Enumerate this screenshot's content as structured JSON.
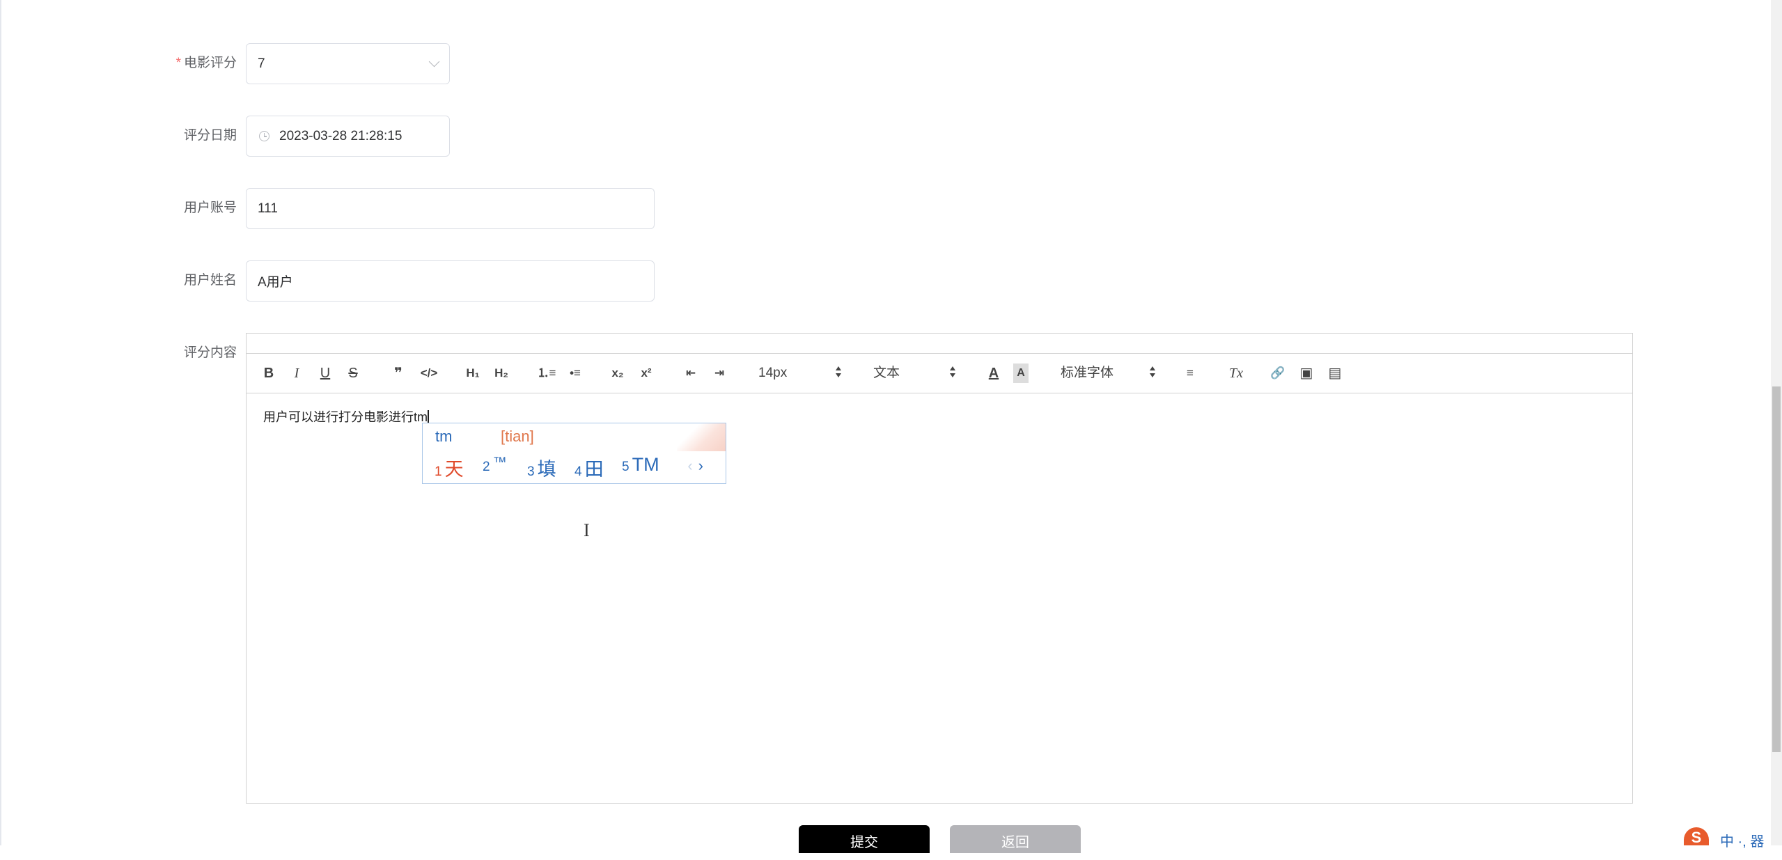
{
  "form": {
    "rating": {
      "label": "电影评分",
      "value": "7"
    },
    "date": {
      "label": "评分日期",
      "value": "2023-03-28 21:28:15"
    },
    "account": {
      "label": "用户账号",
      "value": "111"
    },
    "name": {
      "label": "用户姓名",
      "value": "A用户"
    },
    "content": {
      "label": "评分内容"
    }
  },
  "toolbar": {
    "bold": "B",
    "italic": "I",
    "underline": "U",
    "strike": "S",
    "quote": "❞",
    "code": "</>",
    "h1": "H₁",
    "h2": "H₂",
    "ordered_list": "⒈≡",
    "bullet_list": "•≡",
    "subscript": "x₂",
    "superscript": "x²",
    "outdent": "⇤",
    "indent": "⇥",
    "size": "14px",
    "header": "文本",
    "font": "标准字体",
    "color": "A",
    "background": "A",
    "align": "≡",
    "clean": "Tx",
    "link": "🔗",
    "image": "▣",
    "video": "▤"
  },
  "editor": {
    "text": "用户可以进行打分电影进行tm"
  },
  "ime": {
    "input": "tm",
    "pinyin": "[tian]",
    "candidates": [
      {
        "num": "1",
        "text": "天"
      },
      {
        "num": "2",
        "text": "™"
      },
      {
        "num": "3",
        "text": "填"
      },
      {
        "num": "4",
        "text": "田"
      },
      {
        "num": "5",
        "text": "TM"
      }
    ],
    "prev": "‹",
    "next": "›"
  },
  "buttons": {
    "submit": "提交",
    "back": "返回"
  },
  "tray": {
    "logo": "S",
    "lang": "中 ·, 器"
  },
  "colors": {
    "required": "#f56c6c",
    "ime_blue": "#2b6ab8",
    "ime_orange": "#e0784d",
    "submit_bg": "#000000",
    "back_bg": "#b4b4b8"
  }
}
